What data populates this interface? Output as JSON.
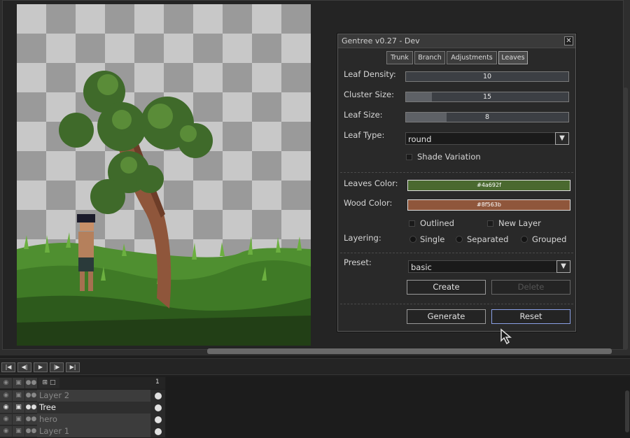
{
  "dialog": {
    "title": "Gentree v0.27 - Dev",
    "close_label": "✕",
    "tabs": [
      "Trunk",
      "Branch",
      "Adjustments",
      "Leaves"
    ],
    "active_tab": "Leaves"
  },
  "leaves": {
    "density": {
      "label": "Leaf Density:",
      "value": "10",
      "fraction": 0.0
    },
    "cluster": {
      "label": "Cluster Size:",
      "value": "15",
      "fraction": 0.16
    },
    "size": {
      "label": "Leaf Size:",
      "value": "8",
      "fraction": 0.25
    },
    "type": {
      "label": "Leaf Type:",
      "value": "round"
    },
    "shade_variation": {
      "label": "Shade Variation",
      "checked": false
    },
    "leaves_color": {
      "label": "Leaves Color:",
      "hex": "#4a692f",
      "display": "#4a692f"
    },
    "wood_color": {
      "label": "Wood Color:",
      "hex": "#8f563b",
      "display": "#8f563b"
    },
    "outlined": {
      "label": "Outlined",
      "checked": false
    },
    "new_layer": {
      "label": "New Layer",
      "checked": false
    },
    "layering": {
      "label": "Layering:",
      "options": [
        "Single",
        "Separated",
        "Grouped"
      ],
      "selected": "Single"
    },
    "preset": {
      "label": "Preset:",
      "value": "basic"
    },
    "create_label": "Create",
    "delete_label": "Delete",
    "generate_label": "Generate",
    "reset_label": "Reset"
  },
  "timeline": {
    "frame_number": "1",
    "layers": [
      {
        "name": "Layer 2",
        "selected": false
      },
      {
        "name": "Tree",
        "selected": true
      },
      {
        "name": "hero",
        "selected": false
      },
      {
        "name": "Layer 1",
        "selected": false
      }
    ],
    "playback_icons": [
      "first-frame-icon",
      "prev-frame-icon",
      "play-icon",
      "next-frame-icon",
      "last-frame-icon"
    ]
  },
  "colors": {
    "leaf_dark": "#3a5a2a",
    "leaf_mid": "#4e7a34",
    "grass_dark": "#2a4a1a",
    "grass_light": "#5fa83a",
    "wood": "#8f563b"
  }
}
